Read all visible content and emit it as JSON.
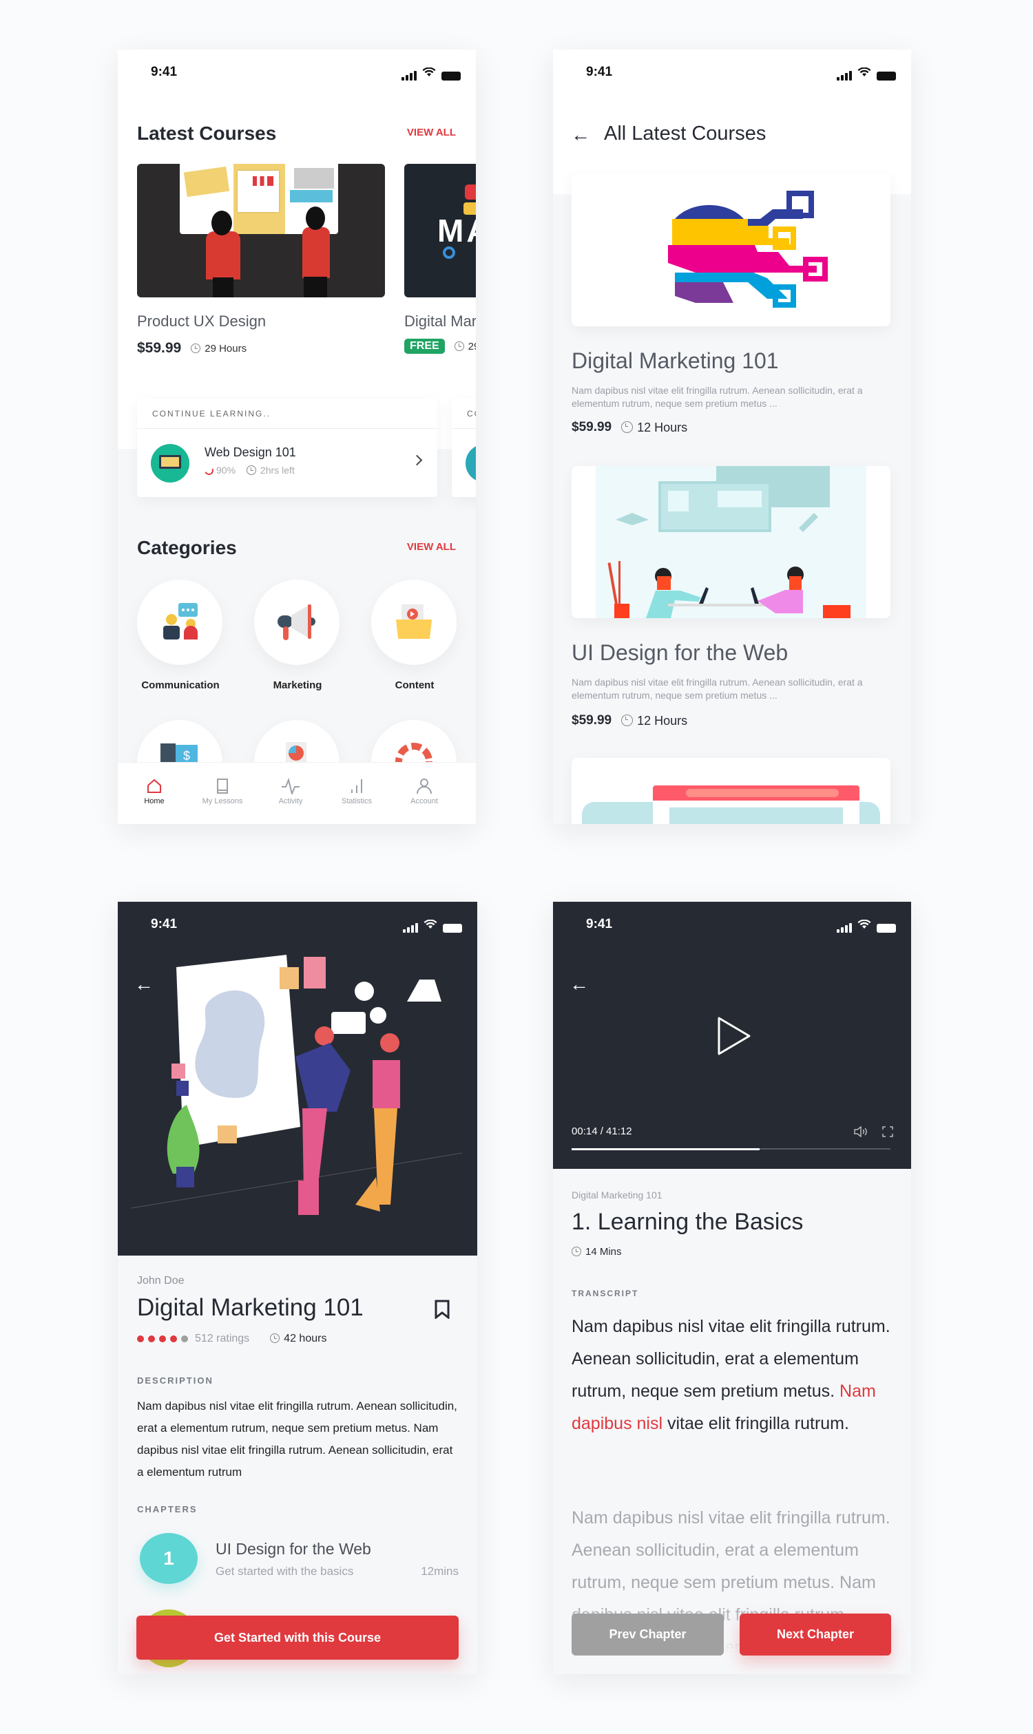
{
  "status_time": "9:41",
  "colors": {
    "accent": "#e0393e",
    "dark": "#262a33",
    "free_badge": "#1fa463",
    "chapter_1": "#5ed6d4",
    "chapter_2": "#b7cc34",
    "prev_button": "#a0a0a0"
  },
  "home": {
    "latest_title": "Latest Courses",
    "view_all": "VIEW ALL",
    "courses": [
      {
        "title": "Product UX Design",
        "price": "$59.99",
        "hours": "29 Hours"
      },
      {
        "title": "Digital Mar",
        "price": "FREE",
        "hours": "29"
      }
    ],
    "continue": {
      "header": "CONTINUE LEARNING..",
      "header_2": "CO",
      "course": "Web Design 101",
      "progress": "90%",
      "progress_value": 90,
      "time_left": "2hrs left"
    },
    "categories_title": "Categories",
    "categories_view_all": "VIEW ALL",
    "categories": [
      {
        "label": "Communication",
        "icon": "people-chat-icon"
      },
      {
        "label": "Marketing",
        "icon": "megaphone-icon"
      },
      {
        "label": "Content",
        "icon": "folder-video-icon"
      },
      {
        "label": "",
        "icon": "money-icon"
      },
      {
        "label": "",
        "icon": "pie-chart-icon"
      },
      {
        "label": "",
        "icon": "lifebuoy-icon"
      }
    ],
    "nav": [
      {
        "label": "Home",
        "icon": "home-icon",
        "active": true
      },
      {
        "label": "My Lessons",
        "icon": "book-icon"
      },
      {
        "label": "Activity",
        "icon": "activity-icon"
      },
      {
        "label": "Statistics",
        "icon": "statistics-icon"
      },
      {
        "label": "Account",
        "icon": "account-icon"
      }
    ]
  },
  "all_courses": {
    "title": "All Latest Courses",
    "items": [
      {
        "title": "Digital Marketing 101",
        "desc": "Nam dapibus nisl vitae elit fringilla rutrum. Aenean sollicitudin, erat a elementum rutrum, neque sem pretium metus ...",
        "price": "$59.99",
        "hours": "12 Hours"
      },
      {
        "title": "UI Design for the Web",
        "desc": "Nam dapibus nisl vitae elit fringilla rutrum. Aenean sollicitudin, erat a elementum rutrum, neque sem pretium metus ...",
        "price": "$59.99",
        "hours": "12 Hours"
      }
    ]
  },
  "detail": {
    "author": "John Doe",
    "title": "Digital Marketing 101",
    "rating": 4,
    "rating_max": 5,
    "ratings": "512 ratings",
    "hours": "42 hours",
    "desc_label": "DESCRIPTION",
    "desc": "Nam dapibus nisl vitae elit fringilla rutrum. Aenean sollicitudin, erat a elementum rutrum, neque sem pretium metus. Nam dapibus nisl vitae elit fringilla rutrum. Aenean sollicitudin, erat a elementum rutrum",
    "chapters_label": "CHAPTERS",
    "chapters": [
      {
        "num": "1",
        "title": "UI Design for the Web",
        "sub": "Get started with the basics",
        "duration": "12mins"
      }
    ],
    "cta": "Get Started with this Course"
  },
  "player": {
    "time": "00:14 / 41:12",
    "progress": 0.59,
    "course": "Digital Marketing 101",
    "lesson": "1. Learning the Basics",
    "duration": "14 Mins",
    "transcript_label": "TRANSCRIPT",
    "p1_before": "Nam dapibus nisl vitae elit fringilla rutrum. Aenean sollicitudin, erat a elementum rutrum, neque sem pretium metus. ",
    "p1_highlight": "Nam dapibus nisl",
    "p1_after": " vitae elit fringilla rutrum.",
    "p2": "Nam dapibus nisl vitae elit fringilla rutrum. Aenean sollicitudin, erat a elementum rutrum, neque sem pretium metus. Nam dapibus nisl vitae elit fringilla rutrum. Aenean sollicitudin, erat a elementum rutrum. Nam dapibus nisl",
    "prev": "Prev Chapter",
    "next": "Next Chapter"
  }
}
